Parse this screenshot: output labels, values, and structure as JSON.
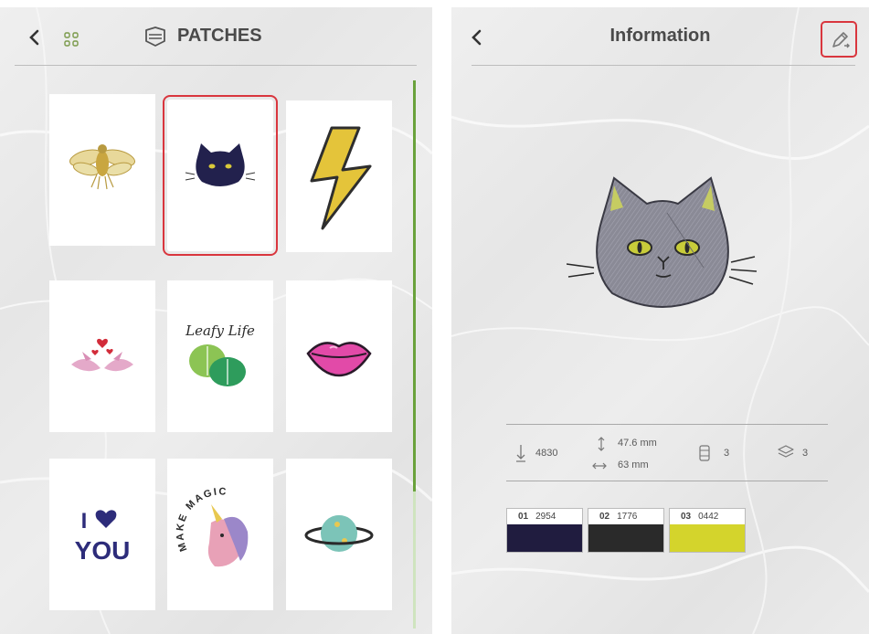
{
  "patches_screen": {
    "title": "PATCHES",
    "patches": [
      {
        "name": "bee"
      },
      {
        "name": "cat",
        "selected": true
      },
      {
        "name": "lightning"
      },
      {
        "name": "love-birds"
      },
      {
        "name": "leafy-life",
        "text": "Leafy Life"
      },
      {
        "name": "lips"
      },
      {
        "name": "i-love-you",
        "text_top": "I",
        "text_bottom": "YOU"
      },
      {
        "name": "unicorn",
        "text": "MAKE MAGIC"
      },
      {
        "name": "planet"
      }
    ]
  },
  "info_screen": {
    "title": "Information",
    "stats": {
      "stitches": "4830",
      "height": "47.6 mm",
      "width": "63 mm",
      "spools": "3",
      "layers": "3"
    },
    "colors": [
      {
        "index": "01",
        "code": "2954",
        "hex": "#201c3f"
      },
      {
        "index": "02",
        "code": "1776",
        "hex": "#2a2a2a"
      },
      {
        "index": "03",
        "code": "0442",
        "hex": "#d4d42c"
      }
    ]
  },
  "accent_colors": {
    "selection": "#d9363e",
    "scrollbar": "#6aa23c"
  }
}
